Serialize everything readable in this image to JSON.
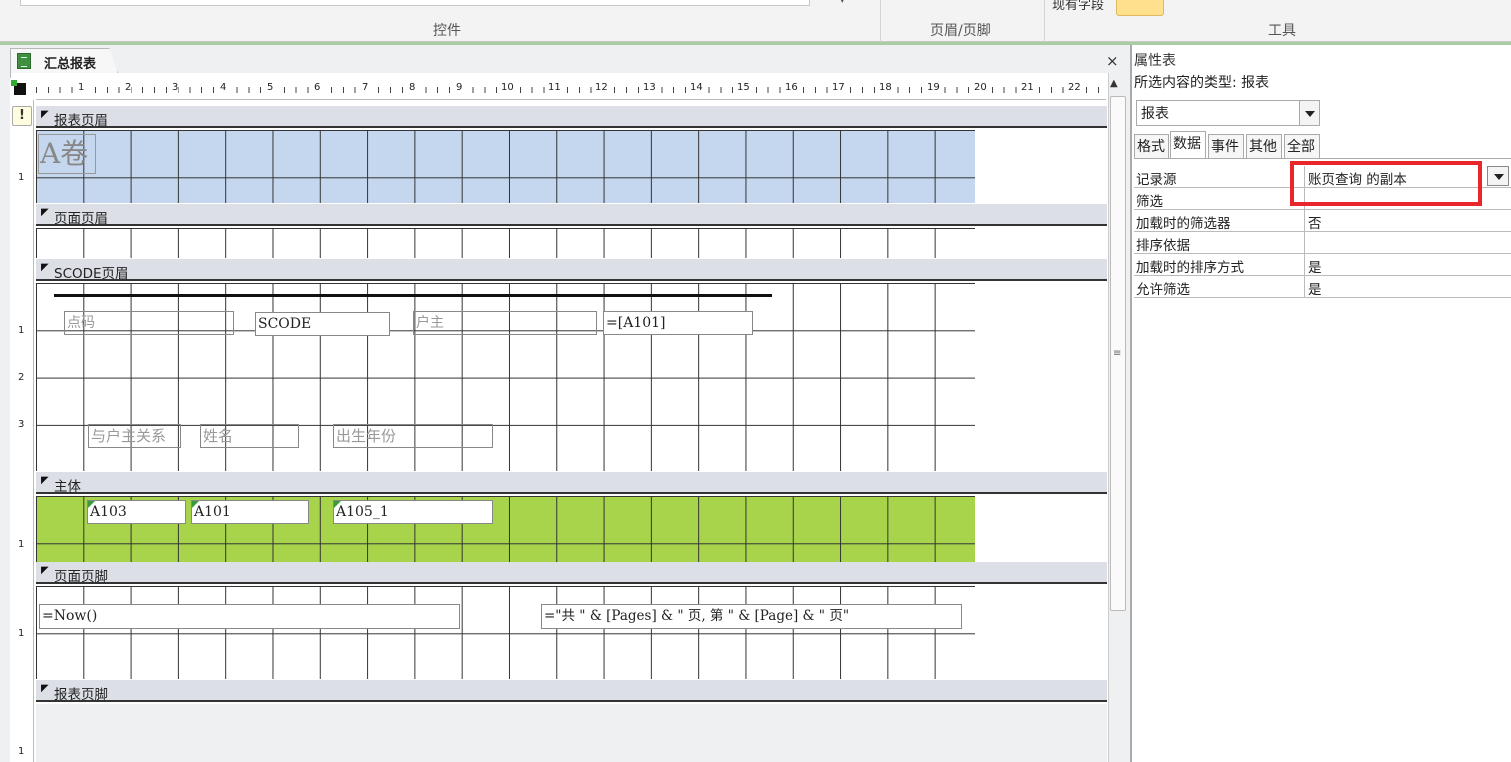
{
  "ribbon": {
    "groups": {
      "controls": "控件",
      "header_footer": "页眉/页脚",
      "tools": "工具"
    },
    "existing_fields": "现有字段"
  },
  "document": {
    "tab_title": "汇总报表",
    "close": "×",
    "ruler_numbers": [
      "1",
      "2",
      "3",
      "4",
      "5",
      "6",
      "7",
      "8",
      "9",
      "10",
      "11",
      "12",
      "13",
      "14",
      "15",
      "16",
      "17",
      "18",
      "19",
      "20",
      "21",
      "22"
    ],
    "vruler_marks": [
      "1",
      "1",
      "1",
      "2",
      "3",
      "1",
      "1",
      "1"
    ]
  },
  "sections": {
    "report_header": "报表页眉",
    "page_header": "页面页眉",
    "scode_header": "SCODE页眉",
    "detail": "主体",
    "page_footer": "页面页脚",
    "report_footer": "报表页脚"
  },
  "controls": {
    "logo": "A卷",
    "point_code": "点码",
    "scode": "SCODE",
    "householder": "户主",
    "a101_expr": "=[A101]",
    "relation": "与户主关系",
    "name": "姓名",
    "birth_year": "出生年份",
    "a103": "A103",
    "a101": "A101",
    "a105": "A105_1",
    "now_expr": "=Now()",
    "page_expr": "=\"共 \" & [Pages] & \" 页, 第 \" & [Page] & \" 页\""
  },
  "property_sheet": {
    "title": "属性表",
    "selection_type": "所选内容的类型: 报表",
    "object_select": "报表",
    "tabs": [
      "格式",
      "数据",
      "事件",
      "其他",
      "全部"
    ],
    "active_tab": "数据",
    "rows": [
      {
        "key": "记录源",
        "value": "账页查询 的副本"
      },
      {
        "key": "筛选",
        "value": ""
      },
      {
        "key": "加载时的筛选器",
        "value": "否"
      },
      {
        "key": "排序依据",
        "value": ""
      },
      {
        "key": "加载时的排序方式",
        "value": "是"
      },
      {
        "key": "允许筛选",
        "value": "是"
      }
    ],
    "highlight_color": "#e8262b"
  }
}
